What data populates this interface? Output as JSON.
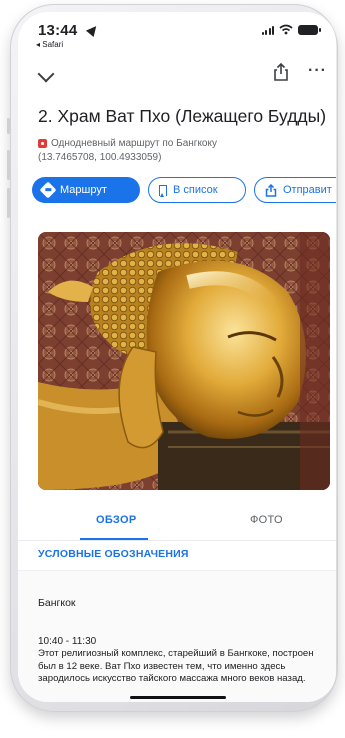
{
  "status_bar": {
    "time": "13:44",
    "back_label": "◂ Safari"
  },
  "place": {
    "title": "2. Храм Ват Пхо (Лежащего Будды)",
    "subtitle": "Однодневный маршрут по Бангкоку",
    "coordinates": "(13.7465708, 100.4933059)"
  },
  "actions": {
    "route_label": "Маршрут",
    "save_label": "В список",
    "send_label": "Отправит"
  },
  "tabs": [
    {
      "label": "ОБЗОР",
      "active": true
    },
    {
      "label": "ФОТО",
      "active": false
    }
  ],
  "legend": {
    "header": "УСЛОВНЫЕ ОБОЗНАЧЕНИЯ"
  },
  "details": {
    "city": "Бангкок",
    "time_range": "10:40 - 11:30",
    "description": "Этот религиозный комплекс, старейший в Бангкоке, построен был в 12 веке. Ват Пхо известен тем, что именно здесь зародилось искусство тайского массажа много веков назад."
  },
  "colors": {
    "accent": "#1a73e8",
    "marker": "#e53935",
    "text": "#202124",
    "secondary_text": "#5f6368"
  },
  "icons": [
    "chevron-down-icon",
    "share-icon",
    "more-icon",
    "map-pin-icon",
    "directions-icon",
    "bookmark-icon",
    "send-icon"
  ]
}
